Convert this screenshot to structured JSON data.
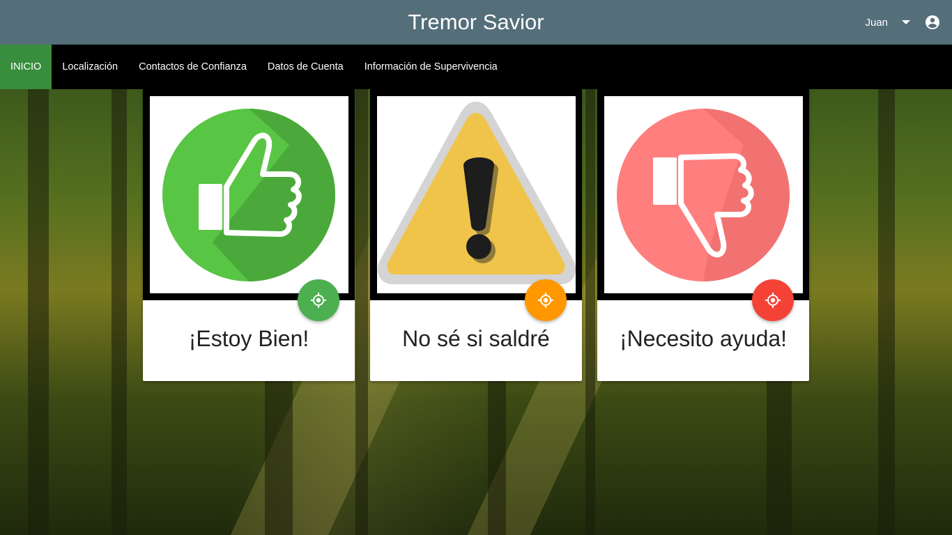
{
  "header": {
    "title": "Tremor Savior",
    "user_name": "Juan",
    "user_menu_icon": "arrow-drop-down-icon",
    "account_icon": "account-circle-icon"
  },
  "nav": {
    "items": [
      {
        "label": "INICIO",
        "active": true
      },
      {
        "label": "Localización"
      },
      {
        "label": "Contactos de Confianza"
      },
      {
        "label": "Datos de Cuenta"
      },
      {
        "label": "Información de Supervivencia"
      }
    ],
    "active_color": "#388e3c"
  },
  "cards": [
    {
      "title": "¡Estoy Bien!",
      "icon": "thumbs-up-icon",
      "fab_icon": "gps-fixed-icon",
      "fab_color": "#4caf50"
    },
    {
      "title": "No sé si saldré",
      "icon": "warning-icon",
      "fab_icon": "gps-fixed-icon",
      "fab_color": "#ff9800"
    },
    {
      "title": "¡Necesito ayuda!",
      "icon": "thumbs-down-icon",
      "fab_icon": "gps-fixed-icon",
      "fab_color": "#f44336"
    }
  ],
  "colors": {
    "header_bg": "#546e7a",
    "navbar_bg": "#000000"
  }
}
